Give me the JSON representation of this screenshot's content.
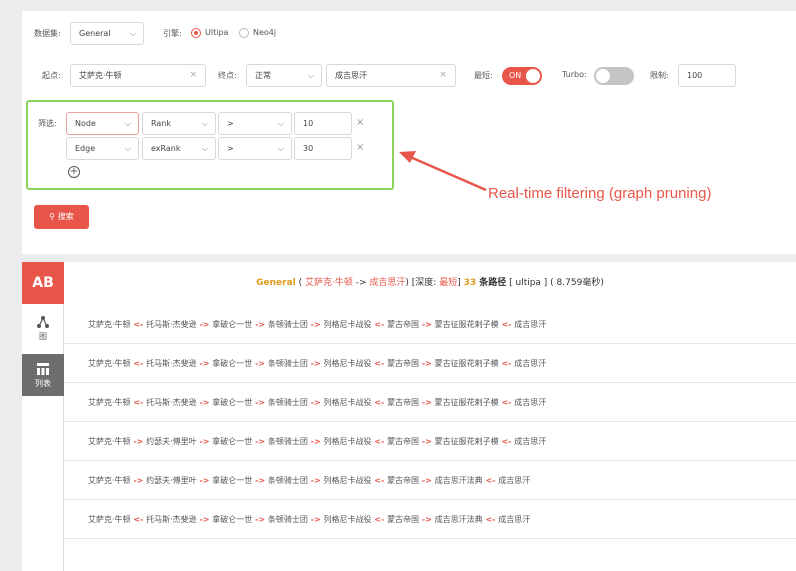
{
  "query": {
    "dataset_label": "数据集:",
    "dataset_value": "General",
    "engine_label": "引擎:",
    "engine_options": [
      "Ultipa",
      "Neo4j"
    ],
    "start_label": "起点:",
    "start_value": "艾萨克·牛顿",
    "end_label": "终点:",
    "end_type_value": "正常",
    "end_value": "成吉思汗",
    "shortest_label": "最短:",
    "shortest_state": "ON",
    "turbo_label": "Turbo:",
    "limit_label": "限制:",
    "limit_value": "100",
    "filter_label": "筛选:",
    "filters": [
      {
        "type": "Node",
        "field": "Rank",
        "op": ">",
        "value": "10"
      },
      {
        "type": "Edge",
        "field": "exRank",
        "op": ">",
        "value": "30"
      }
    ],
    "search_label": "搜索"
  },
  "annotation": "Real-time filtering (graph pruning)",
  "results": {
    "ab_label": "AB",
    "graph_tab_label": "图",
    "list_tab_label": "列表",
    "summary": {
      "dataset": "General",
      "open_paren": " ( ",
      "start": "艾萨克·牛顿",
      "arrow": " -> ",
      "end": "成吉思汗",
      "depth_prefix": ") [深度: ",
      "depth_value": "最短",
      "depth_suffix": "] ",
      "count": "33",
      "count_suffix": " 条路径",
      "tail": " [ ultipa ] ( 8.759毫秒)"
    },
    "paths": [
      [
        "艾萨克·牛顿",
        "<-",
        "托马斯·杰斐逊",
        "->",
        "拿破仑一世",
        "->",
        "条顿骑士团",
        "->",
        "列格尼卡战役",
        "<-",
        "蒙古帝国",
        "->",
        "蒙古征服花剌子模",
        "<-",
        "成吉思汗"
      ],
      [
        "艾萨克·牛顿",
        "<-",
        "托马斯·杰斐逊",
        "->",
        "拿破仑一世",
        "->",
        "条顿骑士团",
        "->",
        "列格尼卡战役",
        "<-",
        "蒙古帝国",
        "->",
        "蒙古征服花剌子模",
        "<-",
        "成吉思汗"
      ],
      [
        "艾萨克·牛顿",
        "<-",
        "托马斯·杰斐逊",
        "->",
        "拿破仑一世",
        "->",
        "条顿骑士团",
        "->",
        "列格尼卡战役",
        "<-",
        "蒙古帝国",
        "->",
        "蒙古征服花剌子模",
        "<-",
        "成吉思汗"
      ],
      [
        "艾萨克·牛顿",
        "->",
        "约瑟夫·傅里叶",
        "->",
        "拿破仑一世",
        "->",
        "条顿骑士团",
        "->",
        "列格尼卡战役",
        "<-",
        "蒙古帝国",
        "->",
        "蒙古征服花剌子模",
        "<-",
        "成吉思汗"
      ],
      [
        "艾萨克·牛顿",
        "->",
        "约瑟夫·傅里叶",
        "->",
        "拿破仑一世",
        "->",
        "条顿骑士团",
        "->",
        "列格尼卡战役",
        "<-",
        "蒙古帝国",
        "->",
        "成吉思汗法典",
        "<-",
        "成吉思汗"
      ],
      [
        "艾萨克·牛顿",
        "<-",
        "托马斯·杰斐逊",
        "->",
        "拿破仑一世",
        "->",
        "条顿骑士团",
        "->",
        "列格尼卡战役",
        "<-",
        "蒙古帝国",
        "->",
        "成吉思汗法典",
        "<-",
        "成吉思汗"
      ]
    ]
  },
  "colors": {
    "accent": "#e8564a",
    "highlight_box": "#8ed35b",
    "count": "#e09a1c"
  }
}
